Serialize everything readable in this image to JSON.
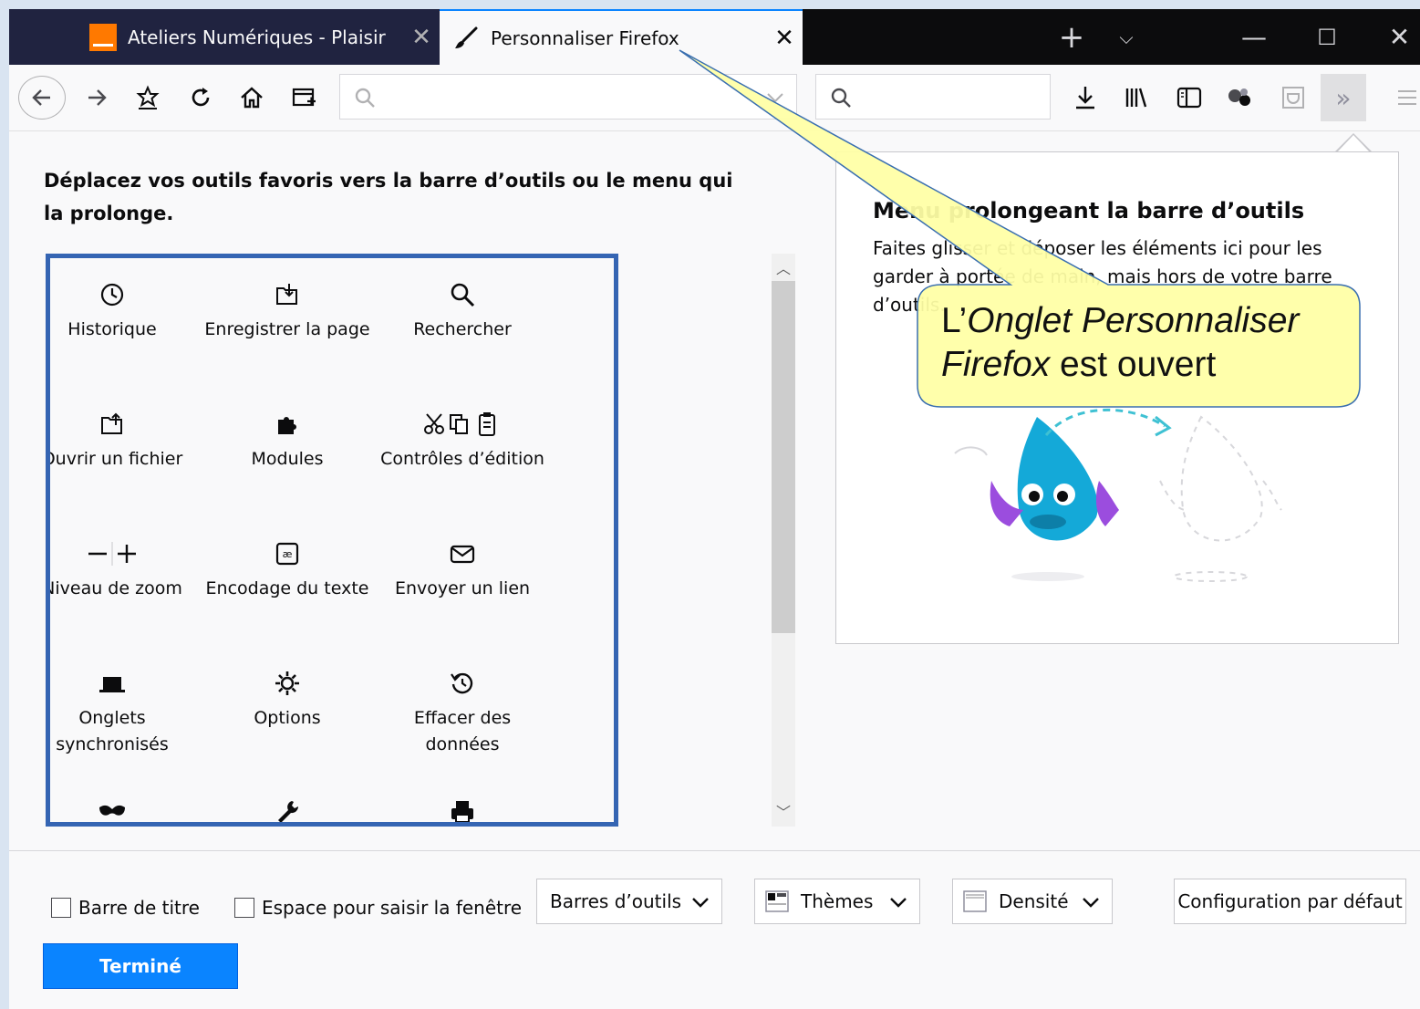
{
  "tabs": [
    {
      "title": "Ateliers Numériques - Plaisir",
      "active": false
    },
    {
      "title": "Personnaliser Firefox",
      "active": true
    }
  ],
  "instruction": "Déplacez vos outils favoris vers la barre d’outils ou le menu qui la prolonge.",
  "palette_items": [
    {
      "label": "Historique",
      "icon": "history-icon"
    },
    {
      "label": "Enregistrer la page",
      "icon": "save-page-icon"
    },
    {
      "label": "Rechercher",
      "icon": "search-icon"
    },
    {
      "label": "Ouvrir un fichier",
      "icon": "open-file-icon"
    },
    {
      "label": "Modules",
      "icon": "puzzle-icon"
    },
    {
      "label": "Contrôles d’édition",
      "icon": "edit-controls-icon"
    },
    {
      "label": "Niveau de zoom",
      "icon": "zoom-icon"
    },
    {
      "label": "Encodage du texte",
      "icon": "text-encoding-icon"
    },
    {
      "label": "Envoyer un lien",
      "icon": "email-link-icon"
    },
    {
      "label": "Onglets synchronisés",
      "icon": "synced-tabs-icon"
    },
    {
      "label": "Options",
      "icon": "gear-icon"
    },
    {
      "label": "Effacer des données",
      "icon": "forget-icon"
    }
  ],
  "panel": {
    "title": "Menu prolongeant la barre d’outils",
    "description": "Faites glisser et déposer les éléments ici pour les garder à portée de main, mais hors de votre barre d’outils."
  },
  "callout": {
    "prefix": "L’",
    "italic": "Onglet Personnaliser Firefox",
    "suffix": " est ouvert"
  },
  "footer": {
    "title_bar_label": "Barre de titre",
    "drag_space_label": "Espace pour saisir la fenêtre",
    "toolbars_label": "Barres d’outils",
    "themes_label": "Thèmes",
    "density_label": "Densité",
    "reset_label": "Configuration par défaut",
    "done_label": "Terminé"
  },
  "colors": {
    "accent": "#0a84ff",
    "palette_border": "#3565b3",
    "callout_fill": "#ffffa6"
  }
}
